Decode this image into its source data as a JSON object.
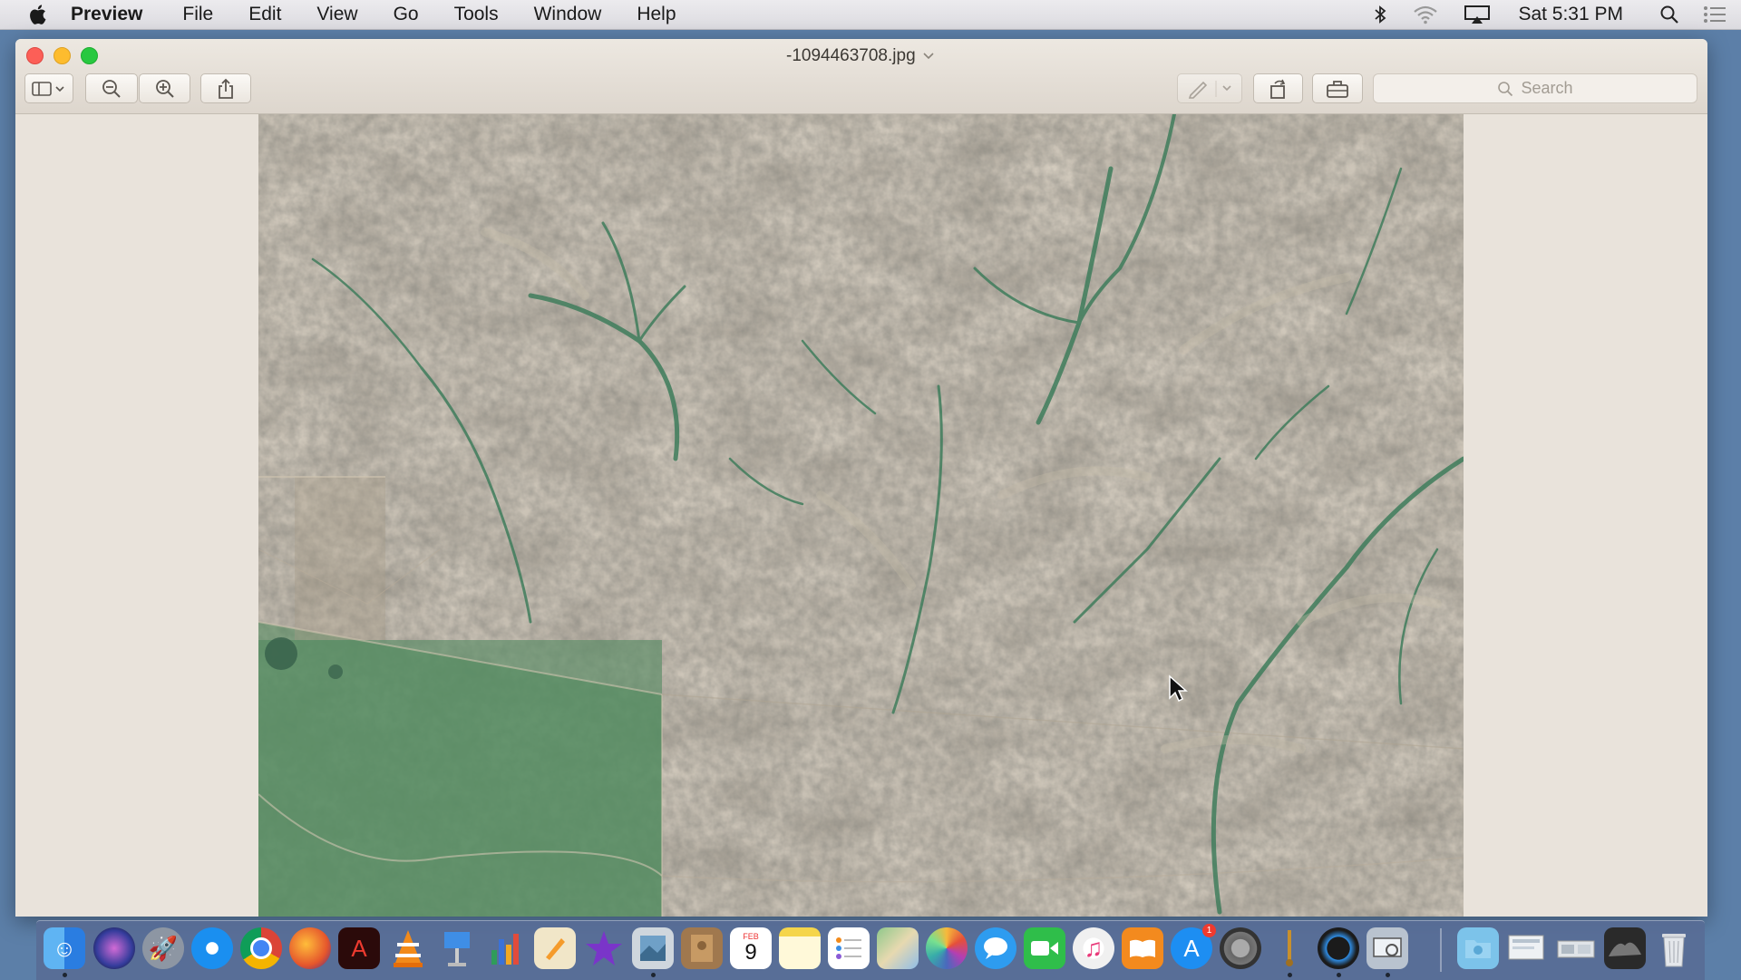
{
  "menubar": {
    "app_name": "Preview",
    "items": [
      "File",
      "Edit",
      "View",
      "Go",
      "Tools",
      "Window",
      "Help"
    ],
    "clock": "Sat 5:31 PM"
  },
  "window": {
    "title": "-1094463708.jpg",
    "search_placeholder": "Search"
  },
  "dock": {
    "apps": [
      "Finder",
      "Siri",
      "Launchpad",
      "Safari",
      "Chrome",
      "Firefox",
      "Acrobat",
      "VLC",
      "Keynote",
      "Numbers",
      "Pages",
      "iMovie",
      "Preview",
      "Contacts",
      "Calendar",
      "Notes",
      "Reminders",
      "Maps",
      "Photos",
      "Messages",
      "FaceTime",
      "iTunes",
      "iBooks",
      "App Store",
      "System Preferences",
      "Instruments",
      "QuickTime",
      "Screenshot",
      "Downloads",
      "Documents",
      "Desktop",
      "Stack",
      "Trash"
    ],
    "calendar_month": "FEB",
    "calendar_day": "9",
    "app_store_badge": "1"
  },
  "colors": {
    "close": "#fc5f57",
    "minimize": "#fdbc2e",
    "zoom": "#28c840",
    "dock_bg": "#586c96"
  }
}
